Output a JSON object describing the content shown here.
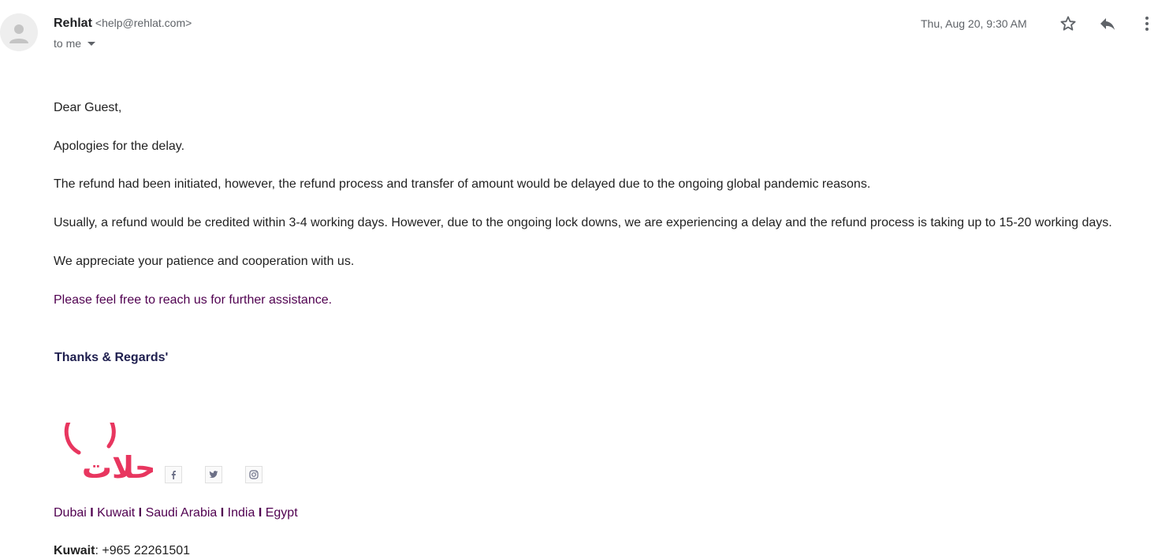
{
  "header": {
    "sender_name": "Rehlat",
    "sender_email": "<help@rehlat.com>",
    "recipient": "to me",
    "date": "Thu, Aug 20, 9:30 AM",
    "icons": [
      "star-icon",
      "reply-icon",
      "more-vert-icon"
    ]
  },
  "body": {
    "greeting": "Dear Guest,",
    "apology": "Apologies for the delay.",
    "paragraph_initiated": "The refund had been initiated, however, the refund process and transfer of amount would be delayed due to the ongoing global pandemic reasons.",
    "paragraph_timeline": "Usually, a refund would be credited within 3-4 working days. However, due to the ongoing lock downs, we are experiencing a delay and the refund process is taking up to 15-20 working days.",
    "appreciation": "We appreciate your patience and cooperation with us.",
    "assistance": "Please feel free to reach us for further assistance.",
    "regards": "Thanks & Regards'"
  },
  "signature": {
    "logo_text": "رحلات",
    "social_icons": [
      "facebook-icon",
      "twitter-icon",
      "instagram-icon"
    ],
    "cities": [
      "Dubai",
      "Kuwait",
      "Saudi Arabia",
      "India",
      "Egypt"
    ],
    "separator": "I",
    "contact_label": "Kuwait",
    "contact_value": ": +965 22261501"
  },
  "colors": {
    "logo": "#e8365f",
    "link_purple": "#500050",
    "regards_navy": "#1f1f4f"
  }
}
